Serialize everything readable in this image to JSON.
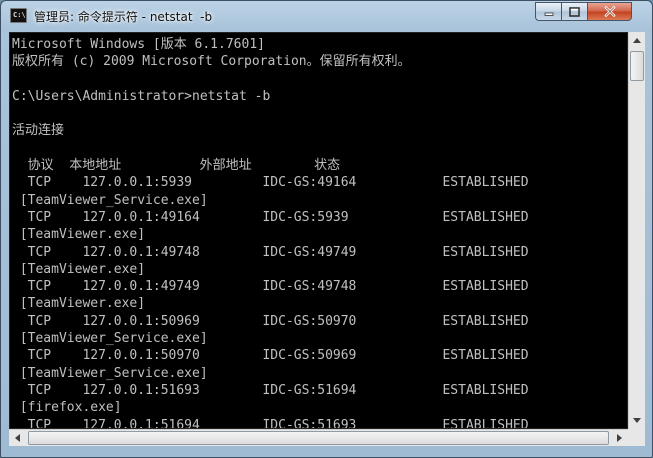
{
  "window": {
    "title": "管理员: 命令提示符 - netstat  -b",
    "icon": "cmd-icon",
    "controls": {
      "minimize": "minimize-icon",
      "maximize": "maximize-icon",
      "close": "close-icon"
    }
  },
  "console": {
    "lines": [
      "Microsoft Windows [版本 6.1.7601]",
      "版权所有 (c) 2009 Microsoft Corporation。保留所有权利。",
      "",
      "C:\\Users\\Administrator>netstat -b",
      "",
      "活动连接",
      "",
      "  协议  本地地址          外部地址        状态",
      "  TCP    127.0.0.1:5939         IDC-GS:49164           ESTABLISHED",
      " [TeamViewer_Service.exe]",
      "  TCP    127.0.0.1:49164        IDC-GS:5939            ESTABLISHED",
      " [TeamViewer.exe]",
      "  TCP    127.0.0.1:49748        IDC-GS:49749           ESTABLISHED",
      " [TeamViewer.exe]",
      "  TCP    127.0.0.1:49749        IDC-GS:49748           ESTABLISHED",
      " [TeamViewer.exe]",
      "  TCP    127.0.0.1:50969        IDC-GS:50970           ESTABLISHED",
      " [TeamViewer_Service.exe]",
      "  TCP    127.0.0.1:50970        IDC-GS:50969           ESTABLISHED",
      " [TeamViewer_Service.exe]",
      "  TCP    127.0.0.1:51693        IDC-GS:51694           ESTABLISHED",
      " [firefox.exe]",
      "  TCP    127.0.0.1:51694        IDC-GS:51693           ESTABLISHED"
    ]
  },
  "colors": {
    "console_bg": "#000000",
    "console_text": "#c0c0c0",
    "close_button": "#c94a2a"
  }
}
